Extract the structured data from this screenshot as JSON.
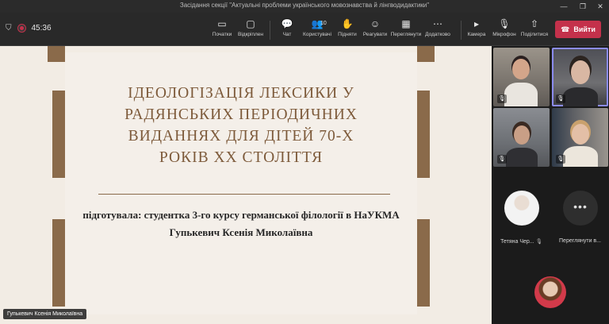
{
  "window": {
    "title": "Засідання секції \"Актуальні проблеми українського мовознавства й лінгводидактики\"",
    "minimize": "—",
    "maximize": "❐",
    "close": "✕"
  },
  "meeting": {
    "timer": "45:36",
    "shield_icon": "⛉",
    "recording_color": "#c4314b"
  },
  "toolbar": {
    "items": [
      {
        "icon": "▭",
        "label": "Початки"
      },
      {
        "icon": "▢",
        "label": "Відкріплен"
      },
      {
        "icon": "💬",
        "label": "Чат"
      },
      {
        "icon": "👥",
        "label": "Користувачі",
        "count": "10"
      },
      {
        "icon": "✋",
        "label": "Підняти"
      },
      {
        "icon": "☺",
        "label": "Реагувати"
      },
      {
        "icon": "▦",
        "label": "Переглянути"
      },
      {
        "icon": "⋯",
        "label": "Додатково"
      },
      {
        "icon": "▸",
        "label": "Камера"
      },
      {
        "icon": "🎙",
        "label": "Мікрофон"
      },
      {
        "icon": "⇧",
        "label": "Поділитися"
      }
    ],
    "leave_icon": "☎",
    "leave_label": "Вийти",
    "leave_color": "#c4314b"
  },
  "slide": {
    "title_lines": [
      "ІДЕОЛОГІЗАЦІЯ ЛЕКСИКИ У",
      "РАДЯНСЬКИХ ПЕРІОДИЧНИХ",
      "ВИДАННЯХ ДЛЯ ДІТЕЙ 70-Х",
      "РОКІВ ХХ СТОЛІТТЯ"
    ],
    "subtitle_lines": [
      "підготувала: студентка 3-го курсу германської філології в НаУКМА",
      "Гупькевич Ксенія Миколаївна"
    ],
    "accent_color": "#8a6a4a",
    "presenter_tag": "Гупькевич Ксенія Миколаївна"
  },
  "participants": {
    "tiles": [
      {
        "name": "",
        "mic": "muted"
      },
      {
        "name": "",
        "mic": "muted"
      },
      {
        "name": "",
        "mic": "muted"
      },
      {
        "name": "",
        "mic": "muted"
      }
    ],
    "avatar_tiles": [
      {
        "name": "Тетяна Чер...",
        "icon": "🎙̸"
      },
      {
        "name": "Переглянути в...",
        "icon": ""
      }
    ],
    "dots": "•••"
  }
}
